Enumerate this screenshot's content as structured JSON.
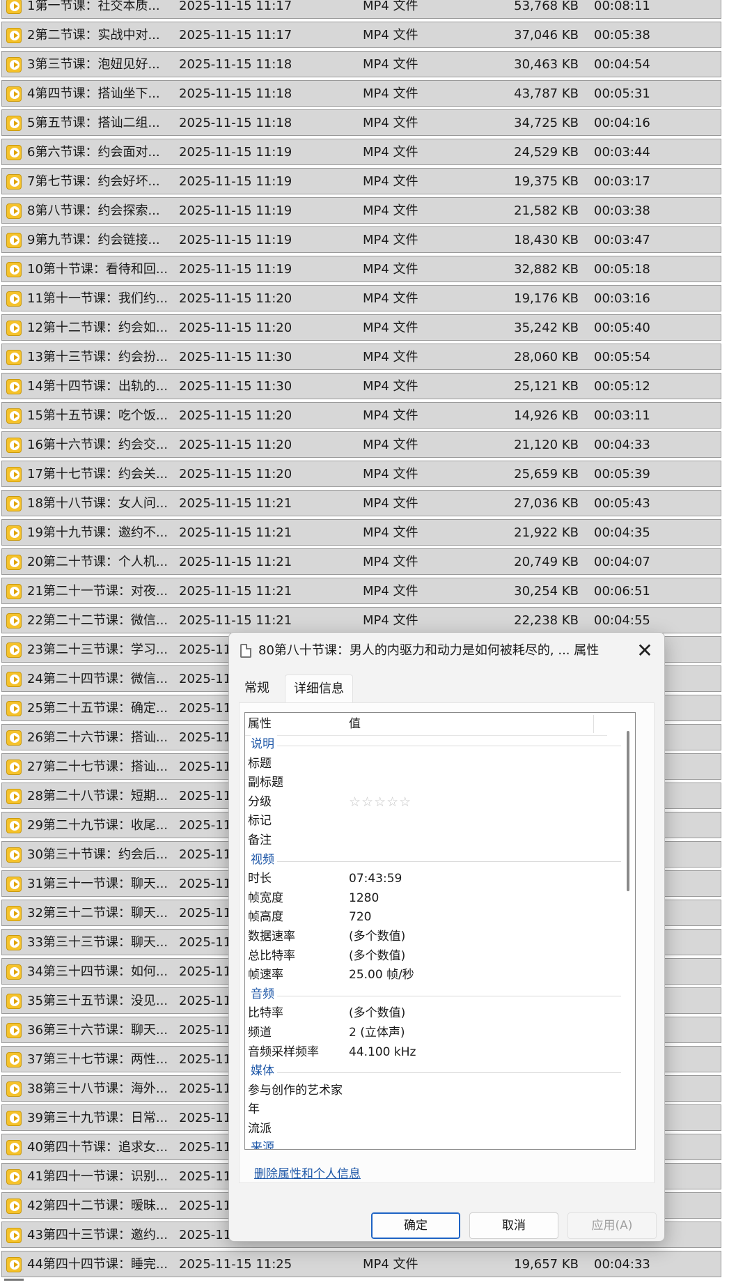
{
  "files": [
    {
      "name": "1第一节课：社交本质...",
      "date": "2025-11-15 11:17",
      "type": "MP4 文件",
      "size": "53,768 KB",
      "duration": "00:08:11"
    },
    {
      "name": "2第二节课：实战中对...",
      "date": "2025-11-15 11:17",
      "type": "MP4 文件",
      "size": "37,046 KB",
      "duration": "00:05:38"
    },
    {
      "name": "3第三节课：泡妞见好...",
      "date": "2025-11-15 11:18",
      "type": "MP4 文件",
      "size": "30,463 KB",
      "duration": "00:04:54"
    },
    {
      "name": "4第四节课：搭讪坐下...",
      "date": "2025-11-15 11:18",
      "type": "MP4 文件",
      "size": "43,787 KB",
      "duration": "00:05:31"
    },
    {
      "name": "5第五节课：搭讪二组...",
      "date": "2025-11-15 11:18",
      "type": "MP4 文件",
      "size": "34,725 KB",
      "duration": "00:04:16"
    },
    {
      "name": "6第六节课：约会面对...",
      "date": "2025-11-15 11:19",
      "type": "MP4 文件",
      "size": "24,529 KB",
      "duration": "00:03:44"
    },
    {
      "name": "7第七节课：约会好坏...",
      "date": "2025-11-15 11:19",
      "type": "MP4 文件",
      "size": "19,375 KB",
      "duration": "00:03:17"
    },
    {
      "name": "8第八节课：约会探索...",
      "date": "2025-11-15 11:19",
      "type": "MP4 文件",
      "size": "21,582 KB",
      "duration": "00:03:38"
    },
    {
      "name": "9第九节课：约会链接...",
      "date": "2025-11-15 11:19",
      "type": "MP4 文件",
      "size": "18,430 KB",
      "duration": "00:03:47"
    },
    {
      "name": "10第十节课：看待和回...",
      "date": "2025-11-15 11:19",
      "type": "MP4 文件",
      "size": "32,882 KB",
      "duration": "00:05:18"
    },
    {
      "name": "11第十一节课：我们约...",
      "date": "2025-11-15 11:20",
      "type": "MP4 文件",
      "size": "19,176 KB",
      "duration": "00:03:16"
    },
    {
      "name": "12第十二节课：约会如...",
      "date": "2025-11-15 11:20",
      "type": "MP4 文件",
      "size": "35,242 KB",
      "duration": "00:05:40"
    },
    {
      "name": "13第十三节课：约会扮...",
      "date": "2025-11-15 11:30",
      "type": "MP4 文件",
      "size": "28,060 KB",
      "duration": "00:05:54"
    },
    {
      "name": "14第十四节课：出轨的...",
      "date": "2025-11-15 11:30",
      "type": "MP4 文件",
      "size": "25,121 KB",
      "duration": "00:05:12"
    },
    {
      "name": "15第十五节课：吃个饭...",
      "date": "2025-11-15 11:20",
      "type": "MP4 文件",
      "size": "14,926 KB",
      "duration": "00:03:11"
    },
    {
      "name": "16第十六节课：约会交...",
      "date": "2025-11-15 11:20",
      "type": "MP4 文件",
      "size": "21,120 KB",
      "duration": "00:04:33"
    },
    {
      "name": "17第十七节课：约会关...",
      "date": "2025-11-15 11:20",
      "type": "MP4 文件",
      "size": "25,659 KB",
      "duration": "00:05:39"
    },
    {
      "name": "18第十八节课：女人问...",
      "date": "2025-11-15 11:21",
      "type": "MP4 文件",
      "size": "27,036 KB",
      "duration": "00:05:43"
    },
    {
      "name": "19第十九节课：邀约不...",
      "date": "2025-11-15 11:21",
      "type": "MP4 文件",
      "size": "21,922 KB",
      "duration": "00:04:35"
    },
    {
      "name": "20第二十节课：个人机...",
      "date": "2025-11-15 11:21",
      "type": "MP4 文件",
      "size": "20,749 KB",
      "duration": "00:04:07"
    },
    {
      "name": "21第二十一节课：对夜...",
      "date": "2025-11-15 11:21",
      "type": "MP4 文件",
      "size": "30,254 KB",
      "duration": "00:06:51"
    },
    {
      "name": "22第二十二节课：微信...",
      "date": "2025-11-15 11:21",
      "type": "MP4 文件",
      "size": "22,238 KB",
      "duration": "00:04:55"
    },
    {
      "name": "23第二十三节课：学习...",
      "date": "2025-11",
      "type": "",
      "size": "",
      "duration": ""
    },
    {
      "name": "24第二十四节课：微信...",
      "date": "2025-11",
      "type": "",
      "size": "",
      "duration": ""
    },
    {
      "name": "25第二十五节课：确定...",
      "date": "2025-11",
      "type": "",
      "size": "",
      "duration": ""
    },
    {
      "name": "26第二十六节课：搭讪...",
      "date": "2025-11",
      "type": "",
      "size": "",
      "duration": ""
    },
    {
      "name": "27第二十七节课：搭讪...",
      "date": "2025-11",
      "type": "",
      "size": "",
      "duration": ""
    },
    {
      "name": "28第二十八节课：短期...",
      "date": "2025-11",
      "type": "",
      "size": "",
      "duration": ""
    },
    {
      "name": "29第二十九节课：收尾...",
      "date": "2025-11",
      "type": "",
      "size": "",
      "duration": ""
    },
    {
      "name": "30第三十节课：约会后...",
      "date": "2025-11",
      "type": "",
      "size": "",
      "duration": ""
    },
    {
      "name": "31第三十一节课：聊天...",
      "date": "2025-11",
      "type": "",
      "size": "",
      "duration": ""
    },
    {
      "name": "32第三十二节课：聊天...",
      "date": "2025-11",
      "type": "",
      "size": "",
      "duration": ""
    },
    {
      "name": "33第三十三节课：聊天...",
      "date": "2025-11",
      "type": "",
      "size": "",
      "duration": ""
    },
    {
      "name": "34第三十四节课：如何...",
      "date": "2025-11",
      "type": "",
      "size": "",
      "duration": ""
    },
    {
      "name": "35第三十五节课：没见...",
      "date": "2025-11",
      "type": "",
      "size": "",
      "duration": ""
    },
    {
      "name": "36第三十六节课：聊天...",
      "date": "2025-11",
      "type": "",
      "size": "",
      "duration": ""
    },
    {
      "name": "37第三十七节课：两性...",
      "date": "2025-11",
      "type": "",
      "size": "",
      "duration": ""
    },
    {
      "name": "38第三十八节课：海外...",
      "date": "2025-11",
      "type": "",
      "size": "",
      "duration": ""
    },
    {
      "name": "39第三十九节课：日常...",
      "date": "2025-11",
      "type": "",
      "size": "",
      "duration": ""
    },
    {
      "name": "40第四十节课：追求女...",
      "date": "2025-11",
      "type": "",
      "size": "",
      "duration": ""
    },
    {
      "name": "41第四十一节课：识别...",
      "date": "2025-11",
      "type": "",
      "size": "",
      "duration": ""
    },
    {
      "name": "42第四十二节课：暧昧...",
      "date": "2025-11",
      "type": "",
      "size": "",
      "duration": ""
    },
    {
      "name": "43第四十三节课：邀约...",
      "date": "2025-11",
      "type": "",
      "size": "",
      "duration": ""
    },
    {
      "name": "44第四十四节课：睡完...",
      "date": "2025-11-15 11:25",
      "type": "MP4 文件",
      "size": "19,657 KB",
      "duration": "00:04:33"
    }
  ],
  "dialog": {
    "title": "80第八十节课：男人的内驱力和动力是如何被耗尽的, ... 属性",
    "close": "✕",
    "tabs": {
      "general": "常规",
      "details": "详细信息"
    },
    "header": {
      "col1": "属性",
      "col2": "值"
    },
    "rows": [
      {
        "kind": "section",
        "name": "说明"
      },
      {
        "kind": "prop",
        "name": "标题",
        "value": ""
      },
      {
        "kind": "prop",
        "name": "副标题",
        "value": ""
      },
      {
        "kind": "prop",
        "name": "分级",
        "value": "☆☆☆☆☆",
        "stars": true
      },
      {
        "kind": "prop",
        "name": "标记",
        "value": ""
      },
      {
        "kind": "prop",
        "name": "备注",
        "value": ""
      },
      {
        "kind": "section",
        "name": "视频"
      },
      {
        "kind": "prop",
        "name": "时长",
        "value": "07:43:59"
      },
      {
        "kind": "prop",
        "name": "帧宽度",
        "value": "1280"
      },
      {
        "kind": "prop",
        "name": "帧高度",
        "value": "720"
      },
      {
        "kind": "prop",
        "name": "数据速率",
        "value": "(多个数值)"
      },
      {
        "kind": "prop",
        "name": "总比特率",
        "value": "(多个数值)"
      },
      {
        "kind": "prop",
        "name": "帧速率",
        "value": "25.00 帧/秒"
      },
      {
        "kind": "section",
        "name": "音频"
      },
      {
        "kind": "prop",
        "name": "比特率",
        "value": "(多个数值)"
      },
      {
        "kind": "prop",
        "name": "频道",
        "value": "2 (立体声)"
      },
      {
        "kind": "prop",
        "name": "音频采样频率",
        "value": "44.100 kHz"
      },
      {
        "kind": "section",
        "name": "媒体"
      },
      {
        "kind": "prop",
        "name": "参与创作的艺术家",
        "value": ""
      },
      {
        "kind": "prop",
        "name": "年",
        "value": ""
      },
      {
        "kind": "prop",
        "name": "流派",
        "value": ""
      },
      {
        "kind": "section",
        "name": "来源"
      }
    ],
    "remove_link": "删除属性和个人信息",
    "buttons": {
      "ok": "确定",
      "cancel": "取消",
      "apply": "应用(A)"
    }
  },
  "colors": {
    "row_bg": "#d7d7d7",
    "icon_yellow": "#f5c22b",
    "link_blue": "#1f58a8",
    "ok_border": "#1e63c4"
  },
  "icons": {
    "file": "video-file-icon",
    "dialog": "document-icon",
    "close": "close-icon",
    "rating": "star-icon"
  }
}
